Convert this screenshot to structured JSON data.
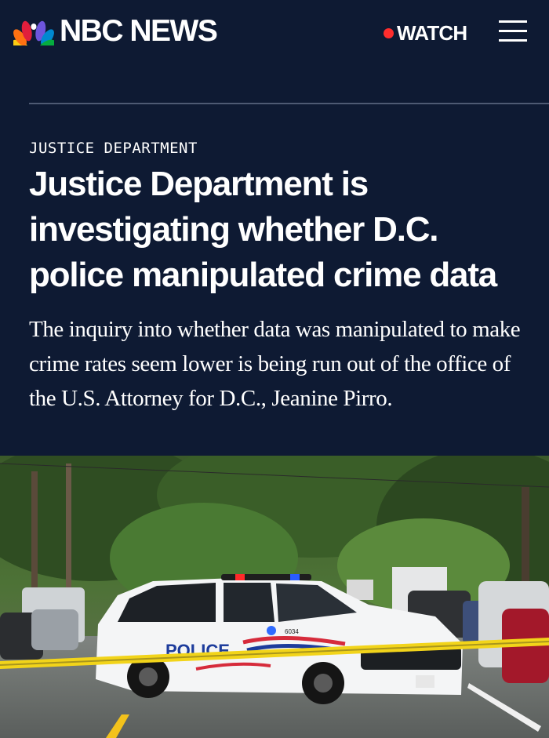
{
  "header": {
    "brand": "NBC NEWS",
    "watch_label": "WATCH",
    "logo_icon": "nbc-peacock-icon",
    "menu_icon": "hamburger-menu-icon"
  },
  "article": {
    "section": "JUSTICE DEPARTMENT",
    "headline": "Justice Department is investigating whether D.C. police manipulated crime data",
    "dek": "The inquiry into whether data was manipulated to make crime rates seem lower is being run out of the office of the U.S. Attorney for D.C., Jeanine Pirro."
  },
  "photo": {
    "vehicle_text": "POLICE",
    "unit_number": "6034"
  },
  "colors": {
    "background": "#0e1a33",
    "live_dot": "#ff2d2d",
    "divider": "#4e5a73"
  }
}
